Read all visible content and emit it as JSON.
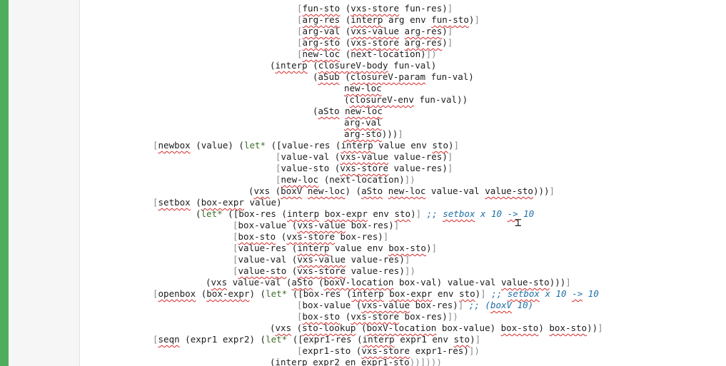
{
  "editor": {
    "lines": [
      {
        "segments": [
          {
            "t": "[",
            "c": "pr"
          },
          {
            "t": "fun-sto",
            "c": "sq"
          },
          {
            "t": " ("
          },
          {
            "t": "vxs-store",
            "c": "sq"
          },
          {
            "t": " fun-res)"
          },
          {
            "t": "]",
            "c": "pr"
          }
        ]
      },
      {
        "segments": [
          {
            "t": "[",
            "c": "pr"
          },
          {
            "t": "arg-res",
            "c": "sq"
          },
          {
            "t": " ("
          },
          {
            "t": "interp",
            "c": "sq"
          },
          {
            "t": " arg env "
          },
          {
            "t": "fun-sto",
            "c": "sq"
          },
          {
            "t": ")"
          },
          {
            "t": "]",
            "c": "pr"
          }
        ]
      },
      {
        "segments": [
          {
            "t": "[",
            "c": "pr"
          },
          {
            "t": "arg-val",
            "c": "sq"
          },
          {
            "t": " ("
          },
          {
            "t": "vxs-value",
            "c": "sq"
          },
          {
            "t": " "
          },
          {
            "t": "arg-res",
            "c": "sq"
          },
          {
            "t": ")"
          },
          {
            "t": "]",
            "c": "pr"
          }
        ]
      },
      {
        "segments": [
          {
            "t": "[",
            "c": "pr"
          },
          {
            "t": "arg-sto",
            "c": "sq"
          },
          {
            "t": " ("
          },
          {
            "t": "vxs-store",
            "c": "sq"
          },
          {
            "t": " "
          },
          {
            "t": "arg-res",
            "c": "sq"
          },
          {
            "t": ")"
          },
          {
            "t": "]",
            "c": "pr"
          }
        ]
      },
      {
        "segments": [
          {
            "t": "[",
            "c": "pr"
          },
          {
            "t": "new-loc",
            "c": "sq"
          },
          {
            "t": " (next-location)"
          },
          {
            "t": "])",
            "c": "pr"
          }
        ]
      },
      {
        "segments": [
          {
            "t": "("
          },
          {
            "t": "interp",
            "c": "sq"
          },
          {
            "t": " ("
          },
          {
            "t": "closureV-body",
            "c": "sq"
          },
          {
            "t": " fun-val)"
          }
        ]
      },
      {
        "segments": [
          {
            "t": "("
          },
          {
            "t": "aSub",
            "c": "sq"
          },
          {
            "t": " ("
          },
          {
            "t": "closureV-param",
            "c": "sq"
          },
          {
            "t": " fun-val)"
          }
        ]
      },
      {
        "segments": [
          {
            "t": "new-loc",
            "c": "sq"
          }
        ]
      },
      {
        "segments": [
          {
            "t": "("
          },
          {
            "t": "closureV-env",
            "c": "sq"
          },
          {
            "t": " fun-val))"
          }
        ]
      },
      {
        "segments": [
          {
            "t": "("
          },
          {
            "t": "aSto",
            "c": "sq"
          },
          {
            "t": " "
          },
          {
            "t": "new-loc",
            "c": "sq"
          }
        ]
      },
      {
        "segments": [
          {
            "t": "arg-val",
            "c": "sq"
          }
        ]
      },
      {
        "segments": [
          {
            "t": "arg-sto",
            "c": "sq"
          },
          {
            "t": ")))"
          },
          {
            "t": "]",
            "c": "pr"
          }
        ]
      },
      {
        "segments": [
          {
            "t": "[",
            "c": "pr"
          },
          {
            "t": "newbox",
            "c": "sq"
          },
          {
            "t": " (value) ("
          },
          {
            "t": "let*",
            "c": "kw"
          },
          {
            "t": " (["
          },
          {
            "t": "value-res ("
          },
          {
            "t": "interp",
            "c": "sq"
          },
          {
            "t": " value env "
          },
          {
            "t": "sto",
            "c": "sq"
          },
          {
            "t": ")"
          },
          {
            "t": "]",
            "c": "pr"
          }
        ]
      },
      {
        "segments": [
          {
            "t": "[",
            "c": "pr"
          },
          {
            "t": "value-val ("
          },
          {
            "t": "vxs-value",
            "c": "sq"
          },
          {
            "t": " value-res)"
          },
          {
            "t": "]",
            "c": "pr"
          }
        ]
      },
      {
        "segments": [
          {
            "t": "[",
            "c": "pr"
          },
          {
            "t": "value-sto ("
          },
          {
            "t": "vxs-store",
            "c": "sq"
          },
          {
            "t": " value-res)"
          },
          {
            "t": "]",
            "c": "pr"
          }
        ]
      },
      {
        "segments": [
          {
            "t": "[",
            "c": "pr"
          },
          {
            "t": "new-loc",
            "c": "sq"
          },
          {
            "t": " (next-location)"
          },
          {
            "t": "])",
            "c": "pr"
          }
        ]
      },
      {
        "segments": [
          {
            "t": "("
          },
          {
            "t": "vxs",
            "c": "sq"
          },
          {
            "t": " ("
          },
          {
            "t": "boxV",
            "c": "sq"
          },
          {
            "t": " "
          },
          {
            "t": "new-loc",
            "c": "sq"
          },
          {
            "t": ") ("
          },
          {
            "t": "aSto",
            "c": "sq"
          },
          {
            "t": " "
          },
          {
            "t": "new-loc",
            "c": "sq"
          },
          {
            "t": " value-val "
          },
          {
            "t": "value-sto",
            "c": "sq"
          },
          {
            "t": ")))"
          },
          {
            "t": "]",
            "c": "pr"
          }
        ]
      },
      {
        "segments": [
          {
            "t": "[",
            "c": "pr"
          },
          {
            "t": "setbox",
            "c": "sq"
          },
          {
            "t": " ("
          },
          {
            "t": "box-expr",
            "c": "sq"
          },
          {
            "t": " value)"
          }
        ]
      },
      {
        "segments": [
          {
            "t": "("
          },
          {
            "t": "let*",
            "c": "kw"
          },
          {
            "t": " (["
          },
          {
            "t": "box-res ("
          },
          {
            "t": "interp",
            "c": "sq"
          },
          {
            "t": " "
          },
          {
            "t": "box-expr",
            "c": "sq"
          },
          {
            "t": " env "
          },
          {
            "t": "sto",
            "c": "sq"
          },
          {
            "t": ")"
          },
          {
            "t": "]",
            "c": "pr"
          },
          {
            "t": " "
          },
          {
            "t": ";; ",
            "c": "cmt"
          },
          {
            "t": "setbox",
            "c": "cmt sq"
          },
          {
            "t": " x 10 ",
            "c": "cmt"
          },
          {
            "t": "->",
            "c": "cmt sq"
          },
          {
            "t": " 10",
            "c": "cmt"
          }
        ]
      },
      {
        "segments": [
          {
            "t": "[",
            "c": "pr"
          },
          {
            "t": "box-value ("
          },
          {
            "t": "vxs-value",
            "c": "sq"
          },
          {
            "t": " box-res)"
          },
          {
            "t": "]",
            "c": "pr"
          }
        ]
      },
      {
        "segments": [
          {
            "t": "[",
            "c": "pr"
          },
          {
            "t": "box-sto",
            "c": "sq"
          },
          {
            "t": " ("
          },
          {
            "t": "vxs-store",
            "c": "sq"
          },
          {
            "t": " box-res)"
          },
          {
            "t": "]",
            "c": "pr"
          }
        ]
      },
      {
        "segments": [
          {
            "t": "[",
            "c": "pr"
          },
          {
            "t": "value-res ("
          },
          {
            "t": "interp",
            "c": "sq"
          },
          {
            "t": " value env "
          },
          {
            "t": "box-sto",
            "c": "sq"
          },
          {
            "t": ")"
          },
          {
            "t": "]",
            "c": "pr"
          }
        ]
      },
      {
        "segments": [
          {
            "t": "[",
            "c": "pr"
          },
          {
            "t": "value-val ("
          },
          {
            "t": "vxs-value",
            "c": "sq"
          },
          {
            "t": " value-res)"
          },
          {
            "t": "]",
            "c": "pr"
          }
        ]
      },
      {
        "segments": [
          {
            "t": "[",
            "c": "pr"
          },
          {
            "t": "value-sto",
            "c": "sq"
          },
          {
            "t": " ("
          },
          {
            "t": "vxs-store",
            "c": "sq"
          },
          {
            "t": " value-res)"
          },
          {
            "t": "])",
            "c": "pr"
          }
        ]
      },
      {
        "segments": [
          {
            "t": "("
          },
          {
            "t": "vxs",
            "c": "sq"
          },
          {
            "t": " value-val ("
          },
          {
            "t": "aSto",
            "c": "sq"
          },
          {
            "t": " ("
          },
          {
            "t": "boxV-location",
            "c": "sq"
          },
          {
            "t": " box-val) value-val "
          },
          {
            "t": "value-sto",
            "c": "sq"
          },
          {
            "t": ")))"
          },
          {
            "t": "]",
            "c": "pr"
          }
        ]
      },
      {
        "segments": [
          {
            "t": "[",
            "c": "pr"
          },
          {
            "t": "openbox",
            "c": "sq"
          },
          {
            "t": " ("
          },
          {
            "t": "box-expr",
            "c": "sq"
          },
          {
            "t": ") ("
          },
          {
            "t": "let*",
            "c": "kw"
          },
          {
            "t": " (["
          },
          {
            "t": "box-res ("
          },
          {
            "t": "interp",
            "c": "sq"
          },
          {
            "t": " "
          },
          {
            "t": "box-expr",
            "c": "sq"
          },
          {
            "t": " env "
          },
          {
            "t": "sto",
            "c": "sq"
          },
          {
            "t": ")"
          },
          {
            "t": "]",
            "c": "pr"
          },
          {
            "t": " "
          },
          {
            "t": ";; ",
            "c": "cmt"
          },
          {
            "t": "setbox",
            "c": "cmt sq"
          },
          {
            "t": " x 10 ",
            "c": "cmt"
          },
          {
            "t": "->",
            "c": "cmt sq"
          },
          {
            "t": " 10",
            "c": "cmt"
          }
        ]
      },
      {
        "segments": [
          {
            "t": "[",
            "c": "pr"
          },
          {
            "t": "box-value ("
          },
          {
            "t": "vxs-value",
            "c": "sq"
          },
          {
            "t": " box-res)"
          },
          {
            "t": "]",
            "c": "pr"
          },
          {
            "t": " "
          },
          {
            "t": ";; (",
            "c": "cmt"
          },
          {
            "t": "boxV",
            "c": "cmt sq"
          },
          {
            "t": " 10)",
            "c": "cmt"
          }
        ]
      },
      {
        "segments": [
          {
            "t": "[",
            "c": "pr"
          },
          {
            "t": "box-sto",
            "c": "sq"
          },
          {
            "t": " ("
          },
          {
            "t": "vxs-store",
            "c": "sq"
          },
          {
            "t": " box-res)"
          },
          {
            "t": "])",
            "c": "pr"
          }
        ]
      },
      {
        "segments": [
          {
            "t": "("
          },
          {
            "t": "vxs",
            "c": "sq"
          },
          {
            "t": " ("
          },
          {
            "t": "sto-lookup",
            "c": "sq"
          },
          {
            "t": " ("
          },
          {
            "t": "boxV-location",
            "c": "sq"
          },
          {
            "t": " box-value) "
          },
          {
            "t": "box-sto",
            "c": "sq"
          },
          {
            "t": ") "
          },
          {
            "t": "box-sto",
            "c": "sq"
          },
          {
            "t": "))"
          },
          {
            "t": "]",
            "c": "pr"
          }
        ]
      },
      {
        "segments": [
          {
            "t": "[",
            "c": "pr"
          },
          {
            "t": "seqn",
            "c": "sq"
          },
          {
            "t": " (expr1 expr2) ("
          },
          {
            "t": "let*",
            "c": "kw"
          },
          {
            "t": " (["
          },
          {
            "t": "expr1-res ("
          },
          {
            "t": "interp",
            "c": "sq"
          },
          {
            "t": " expr1 env "
          },
          {
            "t": "sto",
            "c": "sq"
          },
          {
            "t": ")"
          },
          {
            "t": "]",
            "c": "pr"
          }
        ]
      },
      {
        "segments": [
          {
            "t": "[",
            "c": "pr"
          },
          {
            "t": "expr1-sto ("
          },
          {
            "t": "vxs-store",
            "c": "sq"
          },
          {
            "t": " expr1-res)"
          },
          {
            "t": "])",
            "c": "pr"
          }
        ]
      },
      {
        "segments": [
          {
            "t": "("
          },
          {
            "t": "interp",
            "c": "sq"
          },
          {
            "t": " expr2 en "
          },
          {
            "t": "expr1-sto",
            "c": "sq"
          },
          {
            "t": "))])))",
            "c": "pr"
          }
        ]
      }
    ]
  }
}
